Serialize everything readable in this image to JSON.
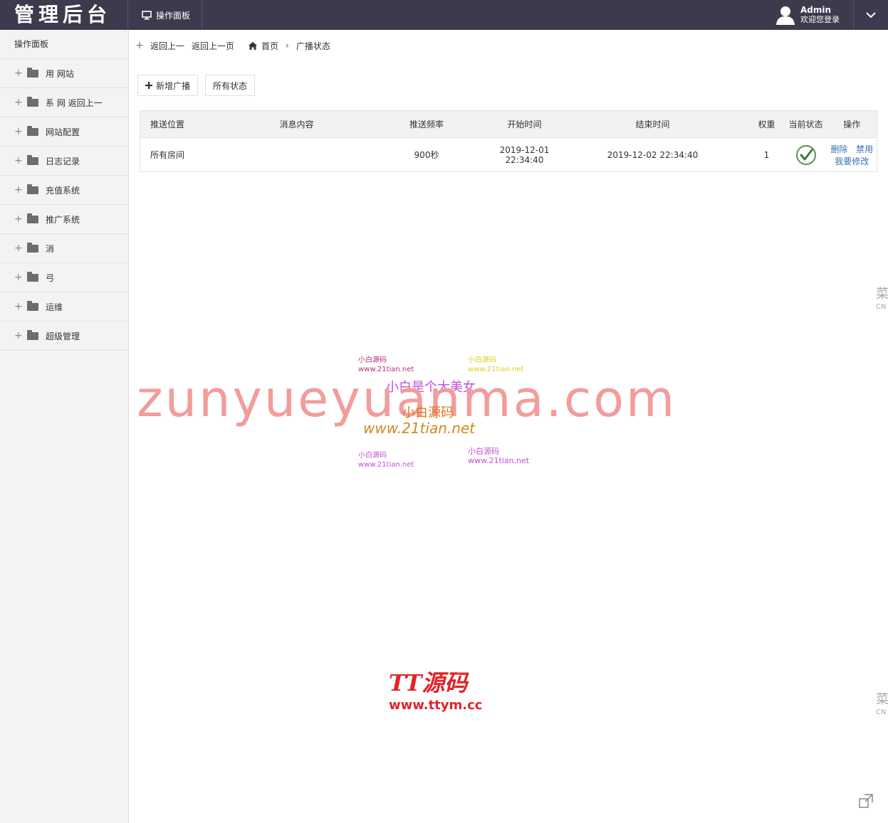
{
  "header": {
    "brand": "管理后台",
    "tab_label": "操作面板",
    "user_name": "Admin",
    "user_welcome": "欢迎您登录"
  },
  "sidebar": {
    "head": "操作面板",
    "items": [
      {
        "label": "用 网站"
      },
      {
        "label": "系 网 返回上一"
      },
      {
        "label": "网站配置"
      },
      {
        "label": "日志记录"
      },
      {
        "label": "充值系统"
      },
      {
        "label": "推广系统"
      },
      {
        "label": "消"
      },
      {
        "label": "弓"
      },
      {
        "label": "运维"
      },
      {
        "label": "超级管理"
      }
    ]
  },
  "breadcrumb": {
    "back_1": "返回上一",
    "back_2": "返回上一页",
    "home": "首页",
    "current": "广播状态"
  },
  "toolbar": {
    "add_label": "新增广播",
    "status_label": "所有状态"
  },
  "table": {
    "headers": [
      "推送位置",
      "消息内容",
      "推送频率",
      "开始时间",
      "结束时间",
      "权重",
      "当前状态",
      "操作"
    ],
    "rows": [
      {
        "position": "所有房间",
        "content": "",
        "frequency": "900秒",
        "start": "2019-12-01 22:34:40",
        "end": "2019-12-02 22:34:40",
        "weight": "1",
        "actions": [
          "删除",
          "禁用",
          "我要修改"
        ]
      }
    ]
  },
  "watermark": {
    "main": "zunyueyuanma.com",
    "small_1a": "小白源码",
    "small_1b": "www.21tian.net",
    "small_2a": "小白源码",
    "small_2b": "www.21tian.net",
    "slogan": "小白是个大美女",
    "mid_1": "小白源码",
    "mid_2": "www.21tian.net",
    "small_3a": "小白源码",
    "small_3b": "www.21tian.net",
    "small_4a": "小白源码",
    "small_4b": "www.21tian.net",
    "tt_title": "TT源码",
    "tt_url": "www.ttym.cc",
    "side_char": "菜",
    "side_sub": "CN"
  }
}
